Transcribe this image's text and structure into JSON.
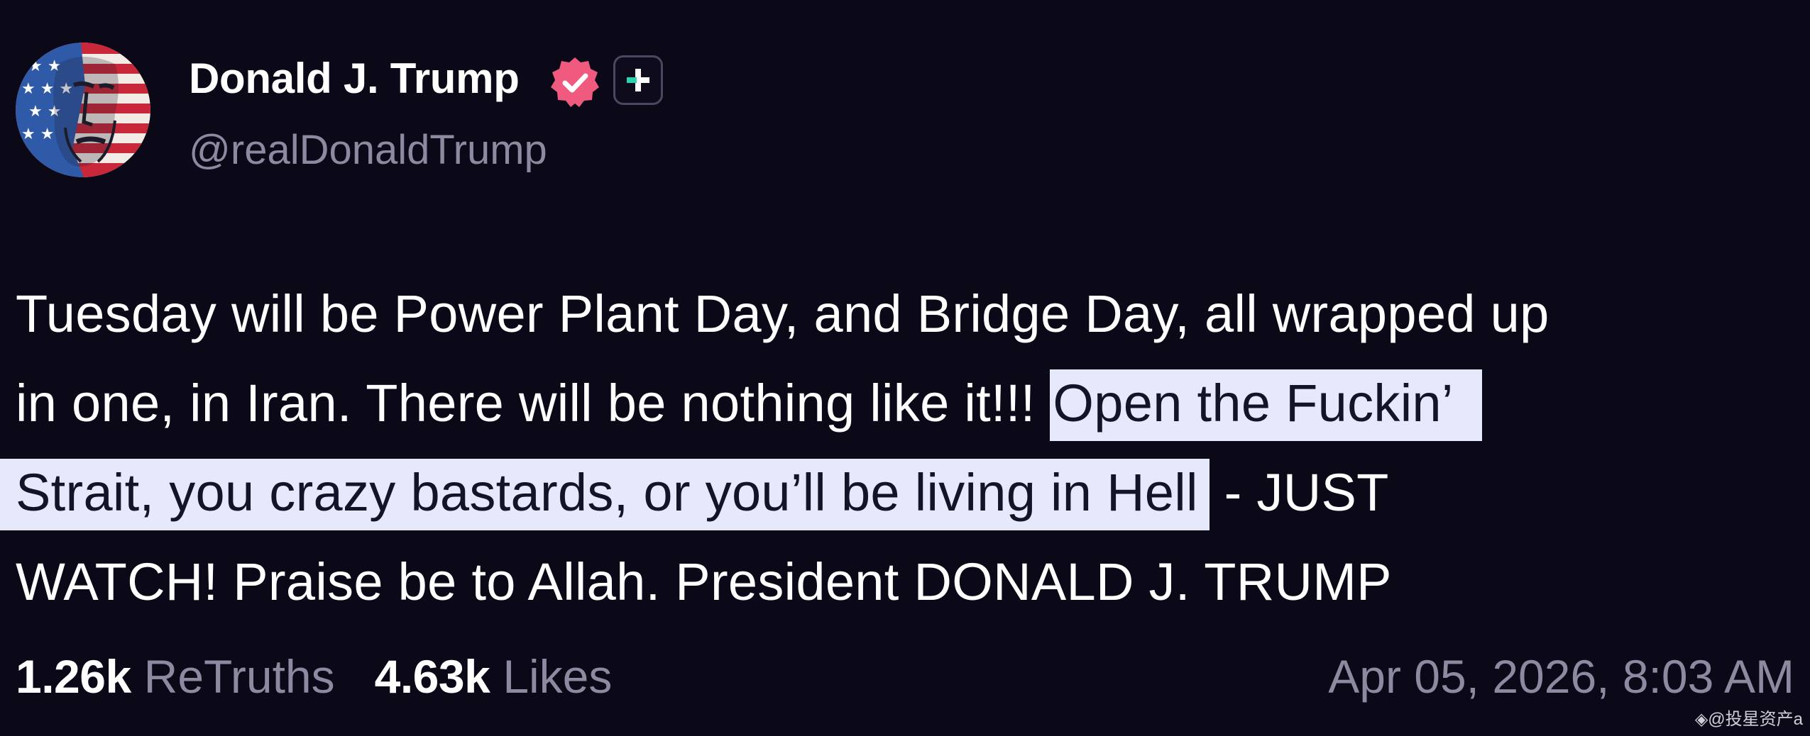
{
  "author": {
    "display_name": "Donald J. Trump",
    "handle": "@realDonaldTrump",
    "avatar_icon": "avatar-flag-portrait",
    "verified_color": "#f05a7e"
  },
  "post": {
    "line1": "Tuesday will be Power Plant Day, and Bridge Day, all wrapped up",
    "line2_plain": "in one, in Iran. There will be nothing like it!!! ",
    "line2_highlight": "Open the Fuckin’",
    "line3_highlight": "Strait, you crazy bastards, or you’ll be living in Hell",
    "line3_plain": " - JUST",
    "line4": "WATCH! Praise be to Allah. President DONALD J. TRUMP",
    "highlight_color": "#e6e8fb"
  },
  "stats": {
    "retruths_count": "1.26k",
    "retruths_label": "ReTruths",
    "likes_count": "4.63k",
    "likes_label": "Likes"
  },
  "timestamp": "Apr 05, 2026, 8:03 AM",
  "watermark": "◈@投星资产a",
  "colors": {
    "background": "#0b0818",
    "text": "#ffffff",
    "muted": "#8c8aa0"
  }
}
